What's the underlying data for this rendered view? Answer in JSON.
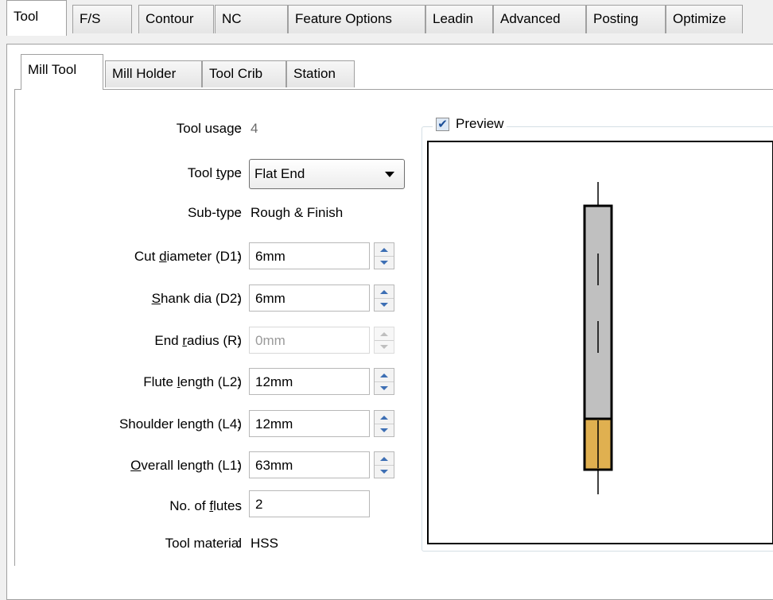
{
  "top_tabs": [
    "Tool",
    "F/S",
    "Contour",
    "NC",
    "Feature Options",
    "Leadin",
    "Advanced",
    "Posting",
    "Optimize"
  ],
  "sub_tabs": [
    "Mill Tool",
    "Mill Holder",
    "Tool Crib",
    "Station"
  ],
  "form": {
    "tool_usage": {
      "label": "Tool usage",
      "value": "4"
    },
    "tool_type": {
      "label_pre": "Tool ",
      "label_ul": "t",
      "label_post": "ype",
      "value": "Flat End"
    },
    "sub_type": {
      "label": "Sub-type",
      "value": "Rough & Finish"
    },
    "cut_diameter": {
      "label_pre": "Cut ",
      "label_ul": "d",
      "label_post": "iameter (D1)",
      "value": "6mm"
    },
    "shank_dia": {
      "label_pre": "",
      "label_ul": "S",
      "label_post": "hank dia (D2)",
      "value": "6mm"
    },
    "end_radius": {
      "label_pre": "End ",
      "label_ul": "r",
      "label_post": "adius (R)",
      "value": "0mm"
    },
    "flute_length": {
      "label_pre": "Flute ",
      "label_ul": "l",
      "label_post": "ength (L2)",
      "value": "12mm"
    },
    "shoulder_length": {
      "label": "Shoulder length (L4)",
      "value": "12mm"
    },
    "overall_length": {
      "label_pre": "",
      "label_ul": "O",
      "label_post": "verall length (L1)",
      "value": "63mm"
    },
    "num_flutes": {
      "label_pre": "No. of ",
      "label_ul": "f",
      "label_post": "lutes",
      "value": "2"
    },
    "tool_material": {
      "label": "Tool material",
      "value": "HSS"
    },
    "colon": ":"
  },
  "preview": {
    "label": "Preview",
    "checked": true,
    "shank_color": "#c0c0c0",
    "flute_color": "#e0b050"
  }
}
